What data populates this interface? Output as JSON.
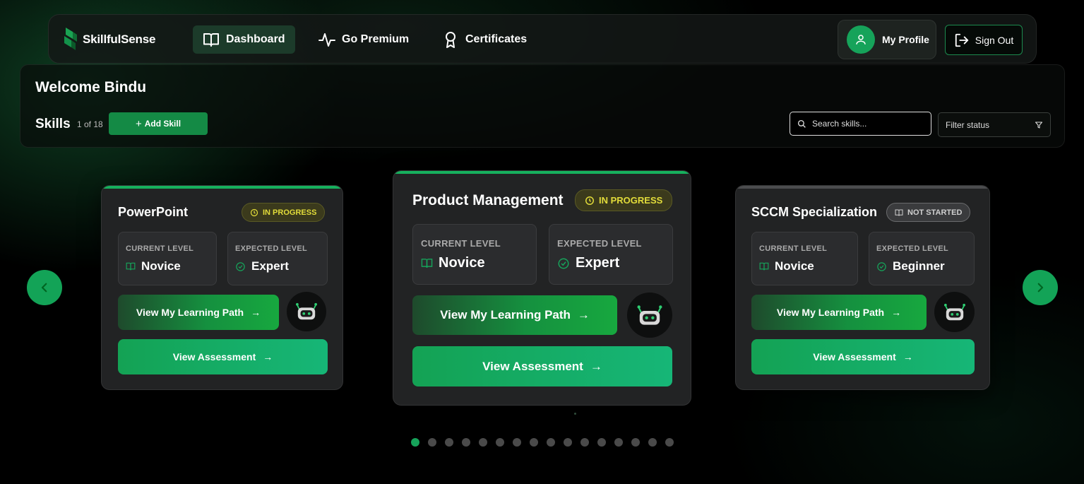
{
  "brand": {
    "name": "SkillfulSense"
  },
  "nav": {
    "dashboard": "Dashboard",
    "premium": "Go Premium",
    "certificates": "Certificates",
    "profile": "My Profile",
    "signout": "Sign Out"
  },
  "header": {
    "welcome": "Welcome Bindu",
    "skills_title": "Skills",
    "skills_count": "1 of 18",
    "add_skill": "Add Skill",
    "search_placeholder": "Search skills...",
    "filter_label": "Filter status"
  },
  "cards": [
    {
      "title": "PowerPoint",
      "status": "IN PROGRESS",
      "current_label": "CURRENT LEVEL",
      "current_value": "Novice",
      "expected_label": "EXPECTED LEVEL",
      "expected_value": "Expert",
      "path_button": "View My Learning Path",
      "assess_button": "View Assessment"
    },
    {
      "title": "Product Management",
      "status": "IN PROGRESS",
      "current_label": "CURRENT LEVEL",
      "current_value": "Novice",
      "expected_label": "EXPECTED LEVEL",
      "expected_value": "Expert",
      "path_button": "View My Learning Path",
      "assess_button": "View Assessment"
    },
    {
      "title": "SCCM Specialization",
      "status": "NOT STARTED",
      "current_label": "CURRENT LEVEL",
      "current_value": "Novice",
      "expected_label": "EXPECTED LEVEL",
      "expected_value": "Beginner",
      "path_button": "View My Learning Path",
      "assess_button": "View Assessment"
    }
  ],
  "pagination": {
    "total": 16,
    "active_index": 0
  },
  "colors": {
    "accent": "#16a35a",
    "in_progress": "#e2dc3a",
    "not_started": "#cfcfcf"
  }
}
